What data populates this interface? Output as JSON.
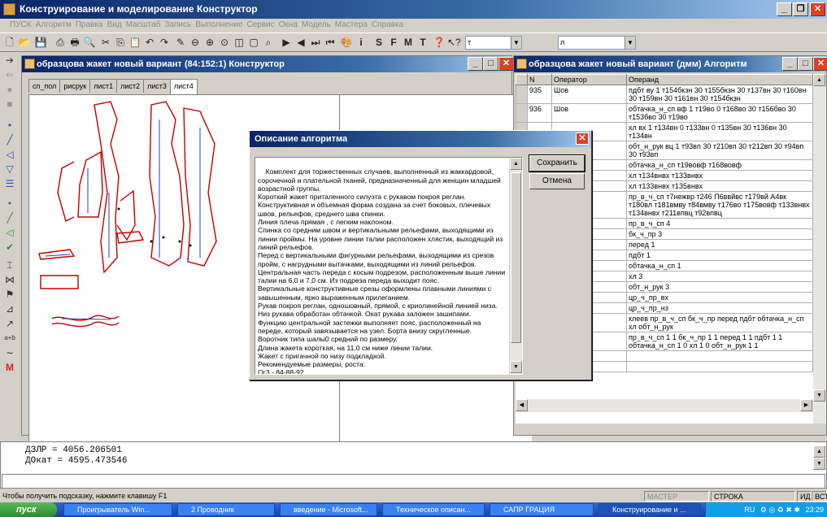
{
  "app": {
    "title": "Конструирование и моделирование  Конструктор"
  },
  "menu": [
    "ПУСК",
    "Алгоритм",
    "Правка",
    "Вид",
    "Масштаб",
    "Запись",
    "Выполнение",
    "Сервис",
    "Окна",
    "Модель",
    "Мастера",
    "Справка"
  ],
  "toolbar": {
    "combo1": "т",
    "combo2": "л",
    "letters": [
      "S",
      "F",
      "M",
      "T"
    ]
  },
  "left_window": {
    "title": "образцова жакет новый вариант (84:152:1) Конструктор",
    "tabs": [
      "сп_пол",
      "рисрук",
      "лист1",
      "лист2",
      "лист3",
      "лист4"
    ],
    "active_tab": "лист4"
  },
  "right_window": {
    "title": "образцова жакет новый вариант (дмм) Алгоритм",
    "columns": [
      "N",
      "Оператор",
      "Операнд"
    ],
    "rows": [
      {
        "n": "935",
        "op": "Шов",
        "operand": "пдбт ву 1 т154бкзн 30 т155бкзн 30 т137вн 30 т160вн 30 т159вн 30 т161вн 30 т154бкзн"
      },
      {
        "n": "936",
        "op": "Шов",
        "operand": "обтачка_н_сп вф 1 т19во 0 т168во 30 т156бво 30 т153бво 30 т19во"
      },
      {
        "n": "",
        "op": "",
        "operand": "хл вх 1 т134вн 0 т133вн 0 т135вн 30 т136вн 30 т134вн"
      },
      {
        "n": "",
        "op": "",
        "operand": "обт_н_рук вц 1 т93вп 30 т210вп 30 т212вп 30 т94вп 30 т93вп"
      },
      {
        "n": "",
        "op": "и",
        "operand": "обтачка_н_сп т19вовф т168вовф"
      },
      {
        "n": "",
        "op": "и",
        "operand": "хл т134внвх т133внвх"
      },
      {
        "n": "",
        "op": "и",
        "operand": "хл т133внвх т135внвх"
      },
      {
        "n": "",
        "op": "нии",
        "operand": "пр_в_ч_сп т7нежвр т246 П6ввйвс т179вй А4вк т180вл т181вмву т84вмву т176во т175вовф т133внвх т134внвх т211впвц т92впвц"
      },
      {
        "n": "",
        "op": "э,%",
        "operand": "пр_в_ч_сп 4"
      },
      {
        "n": "",
        "op": "э,%",
        "operand": "бк_ч_пр 3"
      },
      {
        "n": "",
        "op": "э,%",
        "operand": "перед 1"
      },
      {
        "n": "",
        "op": "э,%",
        "operand": "пдбт 1"
      },
      {
        "n": "",
        "op": "э,%",
        "operand": "обтачка_н_сп 1"
      },
      {
        "n": "",
        "op": "э,%",
        "operand": "хл 3"
      },
      {
        "n": "",
        "op": "э,%",
        "operand": "обт_н_рук 3"
      },
      {
        "n": "",
        "op": "",
        "operand": "цр_ч_пр_вх"
      },
      {
        "n": "",
        "op": "",
        "operand": "цр_ч_пр_нз"
      },
      {
        "n": "",
        "op": "",
        "operand": "клеев пр_в_ч_сп бк_ч_пр перед пдбт обтачка_н_сп хл обт_н_рук"
      },
      {
        "n": "",
        "op": "",
        "operand": "пр_в_ч_сп 1 1 бк_ч_пр 1 1 перед 1 1 пдбт 1 1 обтачка_н_сп 1 0 хл 1 0 обт_н_рук 1 1"
      },
      {
        "n": "954",
        "op": "",
        "operand": ""
      },
      {
        "n": "955",
        "op": "",
        "operand": ""
      }
    ]
  },
  "dialog": {
    "title": "Описание алгоритма",
    "save": "Сохранить",
    "cancel": "Отмена",
    "text": "Комплект для торжественных случаев, выполненный из жаккардовой, сорочечной и плательной тканей, предназначенный для женщин младшей возрастной группы.\nКороткий жакет приталенного силуэта с рукавом покроя реглан. Конструктивная и объемная форма создана за счет боковых, плечевых швов, рельефов, среднего шва спинки.\nЛиния плеча прямая , с легким наклоном.\nСпинка со средним швом и вертикальными рельефами, выходящими из линии проймы. На уровне линии талии расположен хлястик, выходящий из линий рельефов.\nПеред с вертикальными фигурными рельефами, выходящими из срезов пройм, с нагрудными вытачками, выходящими из линий рельефов. Центральная часть переда с косым подрезом, расположенным выше линии талии на 6,0 и 7,0 см. Из подреза переда выходит пояс.\nВертикальные конструктивные срезы оформлены плавными линиями с завышенным, ярко выраженным прилеганием.\nРукав покроя реглан, одношовный, прямой, с криолинейной линией низа. Низ рукава обработан обтачкой. Окат рукава заложен зашипами.\nФункцию центральной застежки выполняет пояс, расположенный на переде, который завязывается на узел. Борта внизу скругленные.\nВоротник типа шалы0 средний по размеру.\nДлина жакета короткая, на 11,0 см ниже линии талии.\nЖакет с пригачной по низу подкладкой.\nРекомендуемые размеры, роста:\nОг3 - 84-88-92"
  },
  "cmd": {
    "line1": "ДЗЛР = 4056.206501",
    "line2": "ДОкат = 4595.473546"
  },
  "status": {
    "hint": "Чтобы получить подсказку, нажмите клавишу F1",
    "p1": "МАСТЕР",
    "p2": "СТРОКА",
    "p3": "ИД",
    "p4": "ВСТ"
  },
  "taskbar": {
    "start": "пуск",
    "tasks": [
      "Проигрыватель Win...",
      "2 Проводник",
      "введение - Microsoft...",
      "Техническое описан...",
      "САПР ГРАЦИЯ",
      "Конструирование и ..."
    ],
    "lang": "RU",
    "clock": "23:29"
  }
}
